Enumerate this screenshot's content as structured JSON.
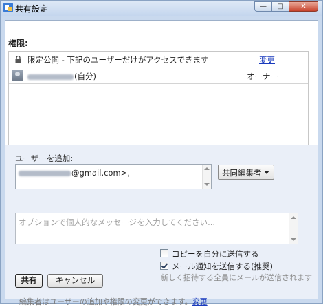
{
  "window": {
    "title": "共有設定",
    "buttons": {
      "minimize": "—",
      "maximize": "□",
      "close": "✕"
    }
  },
  "permissions": {
    "label": "権限:",
    "visibility_text": "限定公開 - 下記のユーザーだけがアクセスできます",
    "change_link": "変更",
    "users": [
      {
        "name_suffix": "(自分)",
        "role": "オーナー"
      }
    ]
  },
  "add_people": {
    "label": "ユーザーを追加:",
    "to_value_suffix": "@gmail.com>,",
    "role_select": "共同編集者",
    "message_placeholder": "オプションで個人的なメッセージを入力してください..."
  },
  "options": {
    "send_copy_label": "コピーを自分に送信する",
    "send_copy_checked": false,
    "notify_label": "メール通知を送信する(推奨)",
    "notify_checked": true,
    "notify_sub": "新しく招待する全員にメールが送信されます"
  },
  "actions": {
    "share": "共有",
    "cancel": "キャンセル"
  },
  "footer": {
    "note": "編集者はユーザーの追加や権限の変更ができます。",
    "link": "変更"
  },
  "colors": {
    "link": "#1a3bbd",
    "panel_bg": "#eaeff8"
  }
}
